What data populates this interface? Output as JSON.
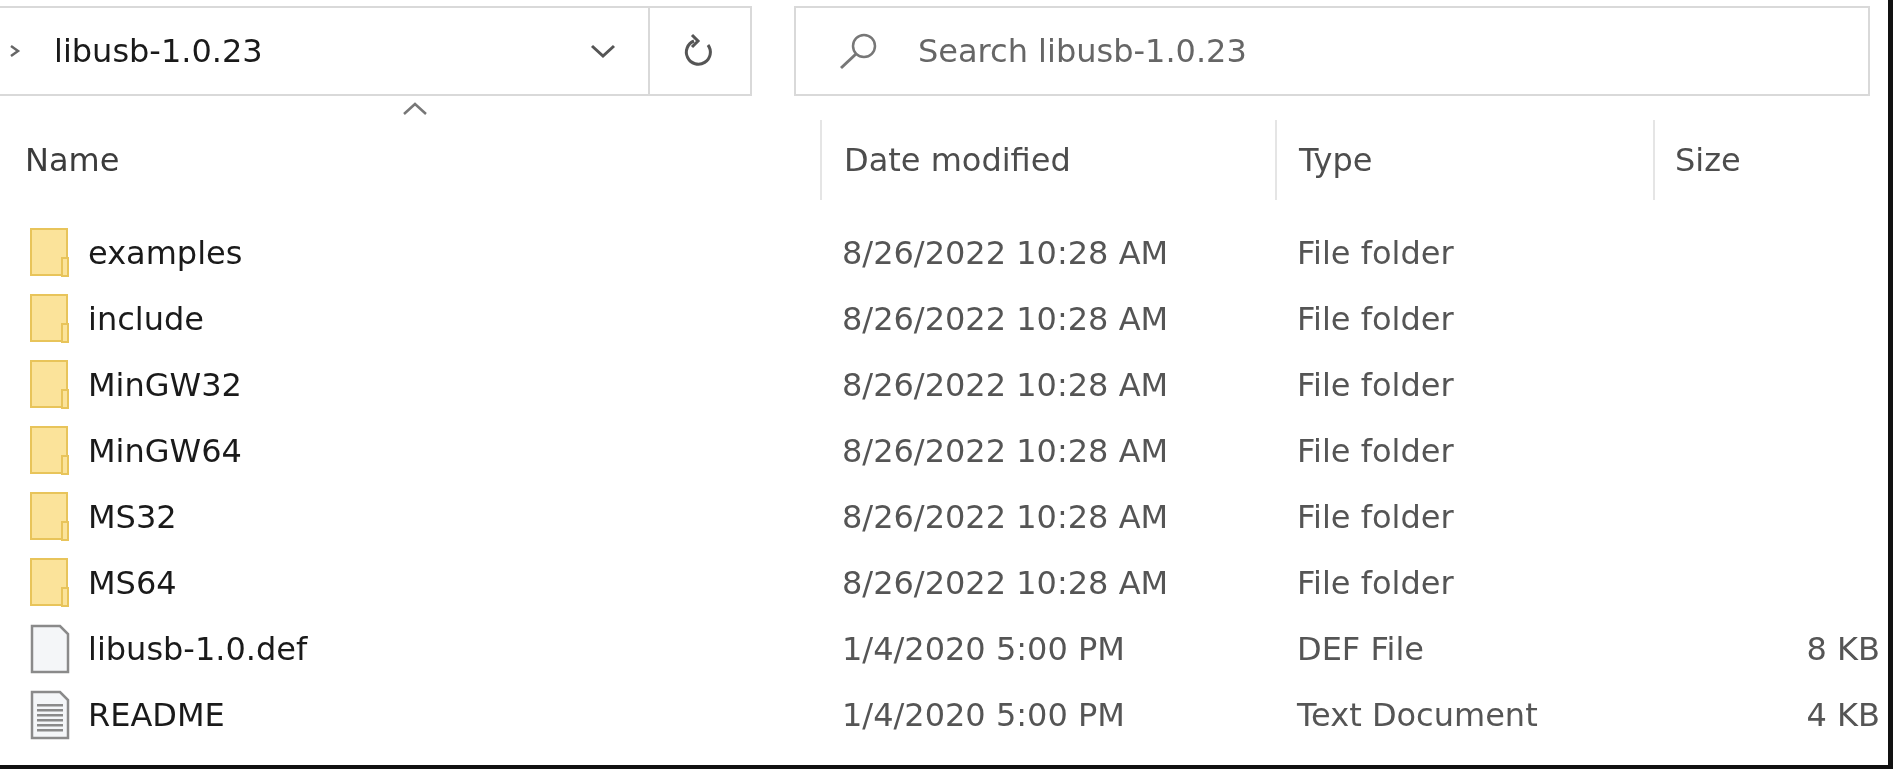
{
  "address_bar": {
    "path": "libusb-1.0.23"
  },
  "search": {
    "placeholder": "Search libusb-1.0.23"
  },
  "columns": [
    {
      "label": "Name",
      "sorted": true
    },
    {
      "label": "Date modified",
      "sorted": false
    },
    {
      "label": "Type",
      "sorted": false
    },
    {
      "label": "Size",
      "sorted": false
    }
  ],
  "rows": [
    {
      "kind": "folder",
      "name": "examples",
      "date": "8/26/2022 10:28 AM",
      "type": "File folder"
    },
    {
      "kind": "folder",
      "name": "include",
      "date": "8/26/2022 10:28 AM",
      "type": "File folder"
    },
    {
      "kind": "folder",
      "name": "MinGW32",
      "date": "8/26/2022 10:28 AM",
      "type": "File folder"
    },
    {
      "kind": "folder",
      "name": "MinGW64",
      "date": "8/26/2022 10:28 AM",
      "type": "File folder"
    },
    {
      "kind": "folder",
      "name": "MS32",
      "date": "8/26/2022 10:28 AM",
      "type": "File folder"
    },
    {
      "kind": "folder",
      "name": "MS64",
      "date": "8/26/2022 10:28 AM",
      "type": "File folder"
    },
    {
      "kind": "file",
      "name": "libusb-1.0.def",
      "date": "1/4/2020 5:00 PM",
      "type": "DEF File",
      "size": "8 KB"
    },
    {
      "kind": "text",
      "name": "README",
      "date": "1/4/2020 5:00 PM",
      "type": "Text Document",
      "size": "4 KB"
    }
  ]
}
